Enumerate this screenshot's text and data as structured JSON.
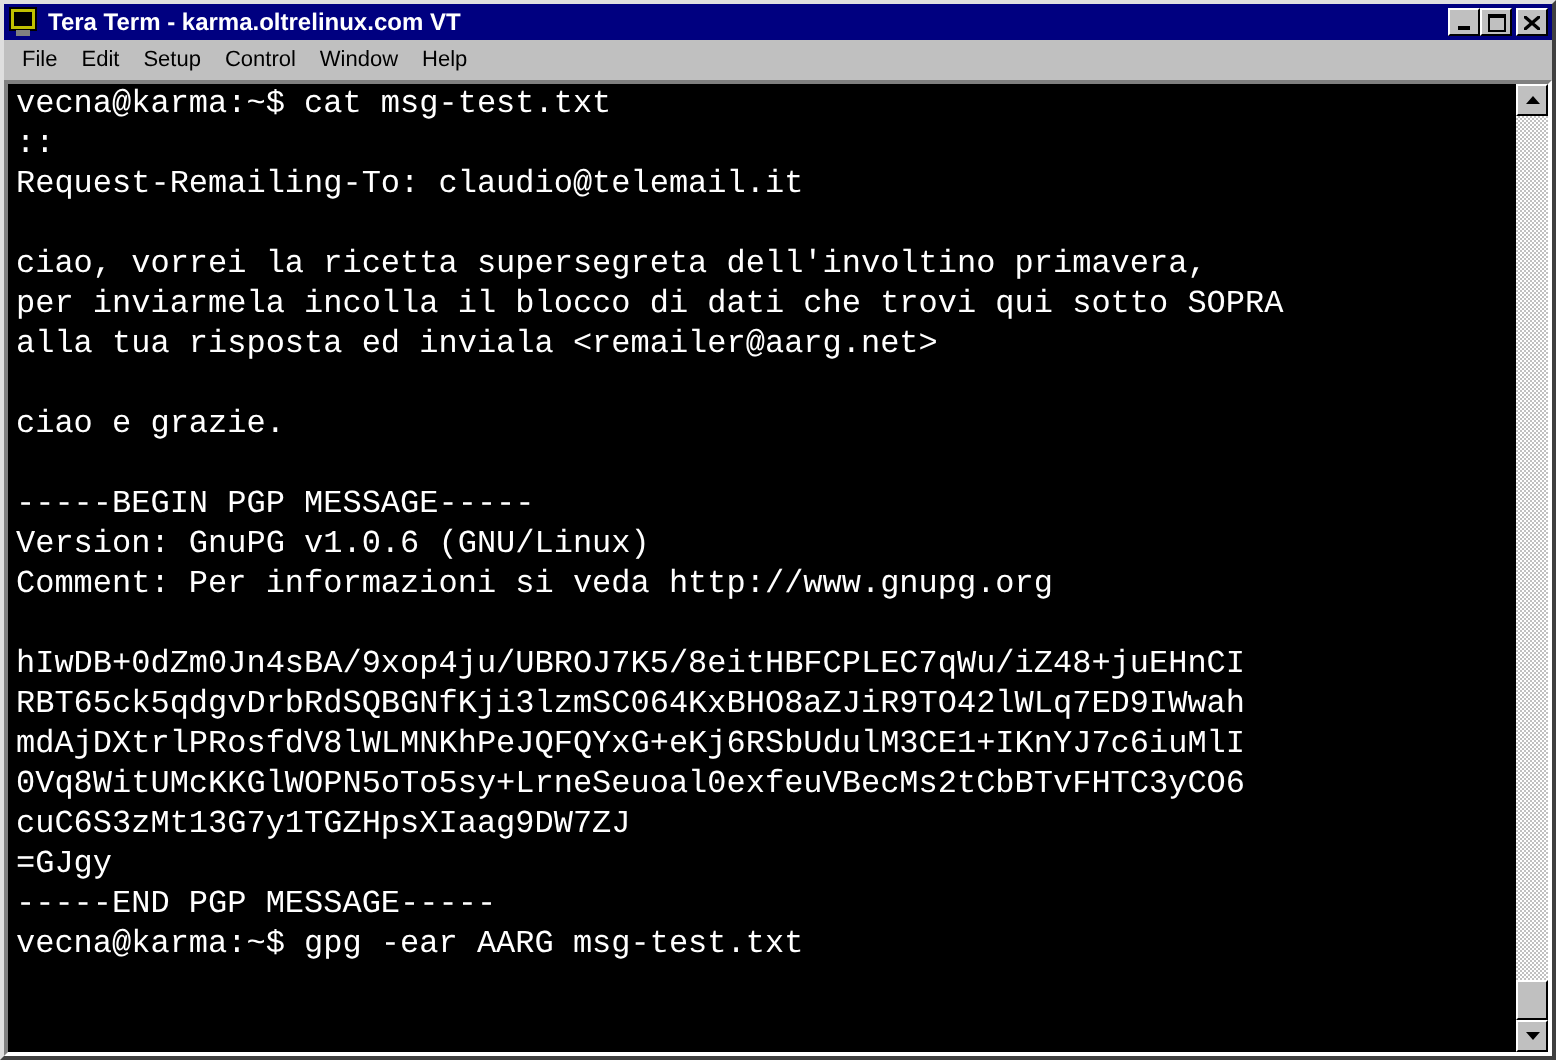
{
  "window": {
    "title": "Tera Term - karma.oltrelinux.com VT"
  },
  "menu": [
    {
      "label": "File"
    },
    {
      "label": "Edit"
    },
    {
      "label": "Setup"
    },
    {
      "label": "Control"
    },
    {
      "label": "Window"
    },
    {
      "label": "Help"
    }
  ],
  "terminal": {
    "blocks": [
      [
        "vecna@karma:~$ cat msg-test.txt",
        "::",
        "Request-Remailing-To: claudio@telemail.it"
      ],
      [
        "ciao, vorrei la ricetta supersegreta dell'involtino primavera,",
        "per inviarmela incolla il blocco di dati che trovi qui sotto SOPRA",
        "alla tua risposta ed inviala <remailer@aarg.net>"
      ],
      [
        "ciao e grazie."
      ],
      [
        "-----BEGIN PGP MESSAGE-----",
        "Version: GnuPG v1.0.6 (GNU/Linux)",
        "Comment: Per informazioni si veda http://www.gnupg.org"
      ],
      [
        "hIwDB+0dZm0Jn4sBA/9xop4ju/UBROJ7K5/8eitHBFCPLEC7qWu/iZ48+juEHnCI",
        "RBT65ck5qdgvDrbRdSQBGNfKji3lzmSC064KxBHO8aZJiR9TO42lWLq7ED9IWwah",
        "mdAjDXtrlPRosfdV8lWLMNKhPeJQFQYxG+eKj6RSbUdulM3CE1+IKnYJ7c6iuMlI",
        "0Vq8WitUMcKKGlWOPN5oTo5sy+LrneSeuoal0exfeuVBecMs2tCbBTvFHTC3yCO6",
        "cuC6S3zMt13G7y1TGZHpsXIaag9DW7ZJ",
        "=GJgy",
        "-----END PGP MESSAGE-----",
        "vecna@karma:~$ gpg -ear AARG msg-test.txt"
      ]
    ]
  }
}
